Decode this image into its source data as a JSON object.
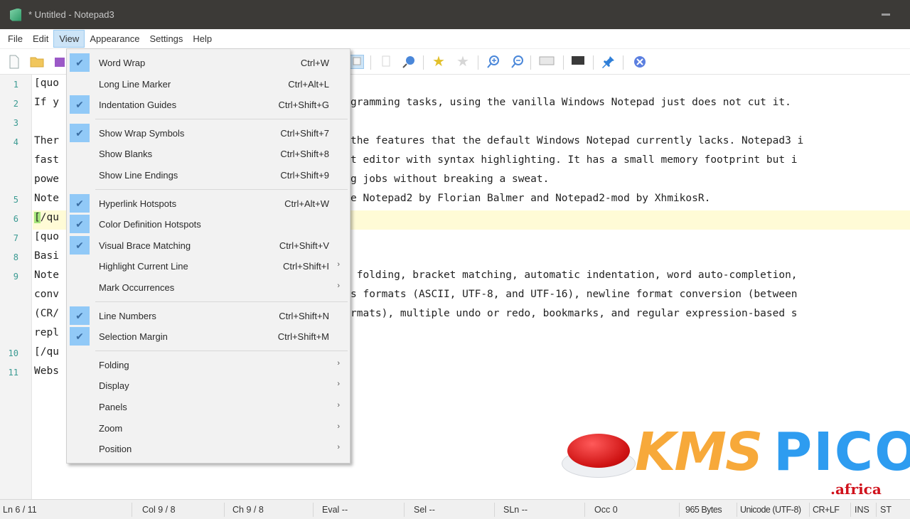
{
  "window": {
    "title": "* Untitled - Notepad3"
  },
  "menubar": {
    "items": [
      "File",
      "Edit",
      "View",
      "Appearance",
      "Settings",
      "Help"
    ]
  },
  "toolbar": {
    "buttons": [
      "new-file",
      "open-folder",
      "save",
      "copy",
      "find",
      "find-replace",
      "bookmark-add",
      "bookmark-clear",
      "zoom-in",
      "zoom-out",
      "view-mode",
      "terminal",
      "pin",
      "close"
    ]
  },
  "view_menu": {
    "groups": [
      [
        {
          "label": "Word Wrap",
          "shortcut": "Ctrl+W",
          "checked": true,
          "submenu": false
        },
        {
          "label": "Long Line Marker",
          "shortcut": "Ctrl+Alt+L",
          "checked": false,
          "submenu": false
        },
        {
          "label": "Indentation Guides",
          "shortcut": "Ctrl+Shift+G",
          "checked": true,
          "submenu": false
        }
      ],
      [
        {
          "label": "Show Wrap Symbols",
          "shortcut": "Ctrl+Shift+7",
          "checked": true,
          "submenu": false
        },
        {
          "label": "Show Blanks",
          "shortcut": "Ctrl+Shift+8",
          "checked": false,
          "submenu": false
        },
        {
          "label": "Show Line Endings",
          "shortcut": "Ctrl+Shift+9",
          "checked": false,
          "submenu": false
        }
      ],
      [
        {
          "label": "Hyperlink Hotspots",
          "shortcut": "Ctrl+Alt+W",
          "checked": true,
          "submenu": false
        },
        {
          "label": "Color Definition Hotspots",
          "shortcut": "",
          "checked": true,
          "submenu": false
        },
        {
          "label": "Visual Brace Matching",
          "shortcut": "Ctrl+Shift+V",
          "checked": true,
          "submenu": false
        },
        {
          "label": "Highlight Current Line",
          "shortcut": "Ctrl+Shift+I",
          "checked": false,
          "submenu": true
        },
        {
          "label": "Mark Occurrences",
          "shortcut": "",
          "checked": false,
          "submenu": true
        }
      ],
      [
        {
          "label": "Line Numbers",
          "shortcut": "Ctrl+Shift+N",
          "checked": true,
          "submenu": false
        },
        {
          "label": "Selection Margin",
          "shortcut": "Ctrl+Shift+M",
          "checked": true,
          "submenu": false
        }
      ],
      [
        {
          "label": "Folding",
          "shortcut": "",
          "checked": false,
          "submenu": true
        },
        {
          "label": "Display",
          "shortcut": "",
          "checked": false,
          "submenu": true
        },
        {
          "label": "Panels",
          "shortcut": "",
          "checked": false,
          "submenu": true
        },
        {
          "label": "Zoom",
          "shortcut": "",
          "checked": false,
          "submenu": true
        },
        {
          "label": "Position",
          "shortcut": "",
          "checked": false,
          "submenu": true
        }
      ]
    ]
  },
  "editor": {
    "current_line": 6,
    "lines": [
      {
        "num": "1",
        "segments": [
          {
            "left": "[quo",
            "right": ""
          }
        ]
      },
      {
        "num": "2",
        "segments": [
          {
            "left": "If y",
            "right": "gramming tasks, using the vanilla Windows Notepad just does not cut it."
          }
        ]
      },
      {
        "num": "3",
        "segments": [
          {
            "left": "",
            "right": ""
          }
        ]
      },
      {
        "num": "4",
        "segments": [
          {
            "left": "Ther",
            "right": "the features that the default Windows Notepad currently lacks. Notepad3 i"
          },
          {
            "left": "fast",
            "right": "t editor with syntax highlighting. It has a small memory footprint but i"
          },
          {
            "left": "powe",
            "right": "g jobs without breaking a sweat."
          }
        ]
      },
      {
        "num": "5",
        "segments": [
          {
            "left": "Note",
            "right": "e Notepad2 by Florian Balmer and Notepad2-mod by XhmikosR."
          }
        ]
      },
      {
        "num": "6",
        "segments": [
          {
            "left": "[/qu",
            "right": ""
          }
        ]
      },
      {
        "num": "7",
        "segments": [
          {
            "left": "[quo",
            "right": ""
          }
        ]
      },
      {
        "num": "8",
        "segments": [
          {
            "left": "Basi",
            "right": ""
          }
        ]
      },
      {
        "num": "9",
        "segments": [
          {
            "left": "Note",
            "right": " folding, bracket matching, automatic indentation, word auto-completion,"
          },
          {
            "left": "conv",
            "right": "s formats (ASCII, UTF-8, and UTF-16), newline format conversion (between"
          },
          {
            "left": "(CR/",
            "right": "rmats), multiple undo or redo, bookmarks, and regular expression-based s"
          },
          {
            "left": "repl",
            "right": ""
          }
        ]
      },
      {
        "num": "10",
        "segments": [
          {
            "left": "[/qu",
            "right": ""
          }
        ]
      },
      {
        "num": "11",
        "segments": [
          {
            "left": "Webs",
            "right": ""
          }
        ]
      }
    ]
  },
  "statusbar": {
    "line": "Ln 6 / 11",
    "col": "Col 9 / 8",
    "ch": "Ch 9 / 8",
    "eval": "Eval --",
    "sel": "Sel --",
    "sln": "SLn --",
    "occ": "Occ 0",
    "size": "965 Bytes",
    "encoding": "Unicode (UTF-8)",
    "eol": "CR+LF",
    "ins": "INS",
    "scheme": "ST"
  },
  "watermark": {
    "brand_left": "KMS",
    "brand_right": "PICO",
    "domain": ".africa"
  }
}
